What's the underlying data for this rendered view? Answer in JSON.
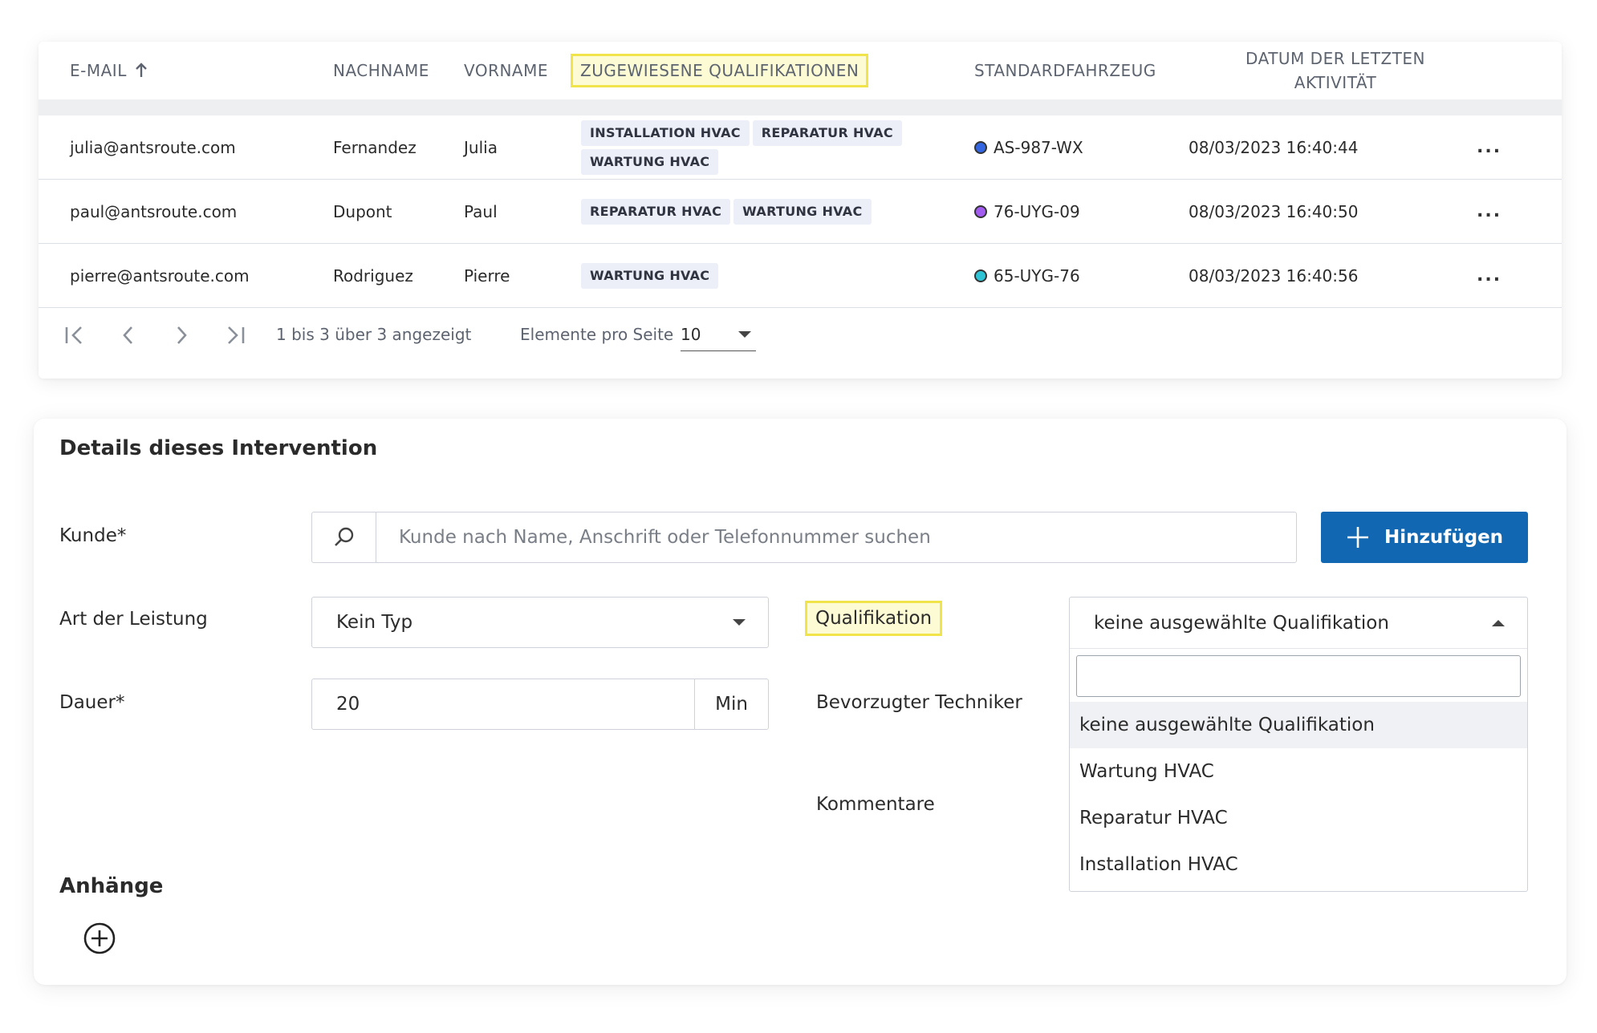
{
  "table": {
    "headers": {
      "email": "E-MAIL",
      "lastname": "NACHNAME",
      "firstname": "VORNAME",
      "qualifications": "ZUGEWIESENE QUALIFIKATIONEN",
      "vehicle": "STANDARDFAHRZEUG",
      "last_activity_line1": "DATUM DER LETZTEN",
      "last_activity_line2": "AKTIVITÄT"
    },
    "rows": [
      {
        "email": "julia@antsroute.com",
        "lastname": "Fernandez",
        "firstname": "Julia",
        "tags": [
          "INSTALLATION HVAC",
          "REPARATUR HVAC",
          "WARTUNG HVAC"
        ],
        "vehicle": "AS-987-WX",
        "vehicle_color": "#3366e0",
        "last_activity": "08/03/2023 16:40:44",
        "more": "..."
      },
      {
        "email": "paul@antsroute.com",
        "lastname": "Dupont",
        "firstname": "Paul",
        "tags": [
          "REPARATUR HVAC",
          "WARTUNG HVAC"
        ],
        "vehicle": "76-UYG-09",
        "vehicle_color": "#a35cf0",
        "last_activity": "08/03/2023 16:40:50",
        "more": "..."
      },
      {
        "email": "pierre@antsroute.com",
        "lastname": "Rodriguez",
        "firstname": "Pierre",
        "tags": [
          "WARTUNG HVAC"
        ],
        "vehicle": "65-UYG-76",
        "vehicle_color": "#2ec4d6",
        "last_activity": "08/03/2023 16:40:56",
        "more": "..."
      }
    ],
    "pagination": {
      "summary": "1 bis 3 über 3 angezeigt",
      "per_page_label": "Elemente pro Seite",
      "per_page_value": "10"
    }
  },
  "details": {
    "title": "Details dieses Intervention",
    "customer_label": "Kunde*",
    "customer_placeholder": "Kunde nach Name, Anschrift oder Telefonnummer suchen",
    "add_button": "Hinzufügen",
    "service_type_label": "Art der Leistung",
    "service_type_value": "Kein Typ",
    "duration_label": "Dauer*",
    "duration_value": "20",
    "duration_unit": "Min",
    "qualification_label": "Qualifikation",
    "qualification_value": "keine ausgewählte Qualifikation",
    "qualification_options": [
      "keine ausgewählte Qualifikation",
      "Wartung HVAC",
      "Reparatur HVAC",
      "Installation HVAC"
    ],
    "technician_label": "Bevorzugter Techniker",
    "comments_label": "Kommentare",
    "attachments_label": "Anhänge"
  },
  "colors": {
    "highlight": "#f0e44a",
    "primary_button": "#1167b1",
    "tag_bg": "#eceef8"
  }
}
